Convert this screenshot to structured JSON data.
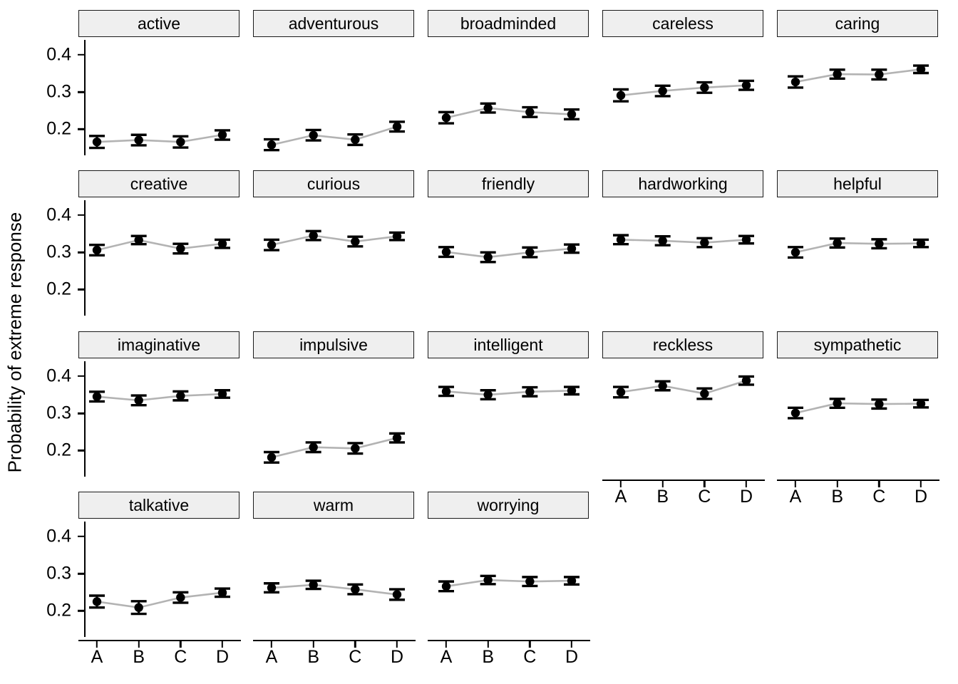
{
  "axis": {
    "y_title": "Probability of extreme response",
    "y_ticks": [
      "0.4",
      "0.3",
      "0.2"
    ],
    "y_tick_values": [
      0.4,
      0.3,
      0.2
    ],
    "x_ticks": [
      "A",
      "B",
      "C",
      "D"
    ]
  },
  "style": {
    "strip_background": "#efefef",
    "strip_border": "#1a1a1a",
    "point_color": "#000000",
    "line_color": "#b3b3b3",
    "panel_background": "#ffffff"
  },
  "chart_data": {
    "type": "line",
    "title": "",
    "xlabel": "",
    "ylabel": "Probability of extreme response",
    "categories": [
      "A",
      "B",
      "C",
      "D"
    ],
    "ylim": [
      0.13,
      0.44
    ],
    "grid": false,
    "legend": "none",
    "error_bars": "95% confidence interval",
    "facet_layout": {
      "rows": 4,
      "cols": 5
    },
    "facets": [
      {
        "name": "active",
        "row": 0,
        "col": 0,
        "values": [
          0.166,
          0.171,
          0.166,
          0.185
        ],
        "err_low": [
          0.15,
          0.157,
          0.151,
          0.172
        ],
        "err_high": [
          0.182,
          0.185,
          0.181,
          0.197
        ]
      },
      {
        "name": "adventurous",
        "row": 0,
        "col": 1,
        "values": [
          0.158,
          0.184,
          0.172,
          0.207
        ],
        "err_low": [
          0.144,
          0.17,
          0.158,
          0.194
        ],
        "err_high": [
          0.173,
          0.198,
          0.186,
          0.22
        ]
      },
      {
        "name": "broadminded",
        "row": 0,
        "col": 2,
        "values": [
          0.231,
          0.257,
          0.246,
          0.24
        ],
        "err_low": [
          0.216,
          0.245,
          0.233,
          0.227
        ],
        "err_high": [
          0.246,
          0.269,
          0.259,
          0.253
        ]
      },
      {
        "name": "careless",
        "row": 0,
        "col": 3,
        "values": [
          0.291,
          0.303,
          0.312,
          0.318
        ],
        "err_low": [
          0.275,
          0.289,
          0.298,
          0.306
        ],
        "err_high": [
          0.307,
          0.317,
          0.326,
          0.33
        ]
      },
      {
        "name": "caring",
        "row": 0,
        "col": 4,
        "values": [
          0.327,
          0.348,
          0.347,
          0.361
        ],
        "err_low": [
          0.312,
          0.336,
          0.334,
          0.351
        ],
        "err_high": [
          0.342,
          0.36,
          0.36,
          0.371
        ]
      },
      {
        "name": "creative",
        "row": 1,
        "col": 0,
        "values": [
          0.306,
          0.333,
          0.31,
          0.323
        ],
        "err_low": [
          0.292,
          0.322,
          0.297,
          0.312
        ],
        "err_high": [
          0.32,
          0.344,
          0.323,
          0.334
        ]
      },
      {
        "name": "curious",
        "row": 1,
        "col": 1,
        "values": [
          0.32,
          0.345,
          0.329,
          0.343
        ],
        "err_low": [
          0.306,
          0.333,
          0.316,
          0.333
        ],
        "err_high": [
          0.334,
          0.357,
          0.342,
          0.353
        ]
      },
      {
        "name": "friendly",
        "row": 1,
        "col": 2,
        "values": [
          0.301,
          0.287,
          0.3,
          0.31
        ],
        "err_low": [
          0.288,
          0.274,
          0.287,
          0.299
        ],
        "err_high": [
          0.314,
          0.3,
          0.313,
          0.321
        ]
      },
      {
        "name": "hardworking",
        "row": 1,
        "col": 3,
        "values": [
          0.334,
          0.331,
          0.326,
          0.334
        ],
        "err_low": [
          0.322,
          0.319,
          0.314,
          0.324
        ],
        "err_high": [
          0.346,
          0.343,
          0.338,
          0.344
        ]
      },
      {
        "name": "helpful",
        "row": 1,
        "col": 4,
        "values": [
          0.3,
          0.325,
          0.323,
          0.324
        ],
        "err_low": [
          0.286,
          0.313,
          0.311,
          0.314
        ],
        "err_high": [
          0.314,
          0.337,
          0.335,
          0.334
        ]
      },
      {
        "name": "imaginative",
        "row": 2,
        "col": 0,
        "values": [
          0.345,
          0.335,
          0.347,
          0.352
        ],
        "err_low": [
          0.332,
          0.322,
          0.335,
          0.342
        ],
        "err_high": [
          0.358,
          0.348,
          0.359,
          0.362
        ]
      },
      {
        "name": "impulsive",
        "row": 2,
        "col": 1,
        "values": [
          0.182,
          0.209,
          0.206,
          0.234
        ],
        "err_low": [
          0.168,
          0.196,
          0.192,
          0.222
        ],
        "err_high": [
          0.196,
          0.222,
          0.22,
          0.246
        ]
      },
      {
        "name": "intelligent",
        "row": 2,
        "col": 2,
        "values": [
          0.359,
          0.35,
          0.358,
          0.361
        ],
        "err_low": [
          0.347,
          0.338,
          0.346,
          0.351
        ],
        "err_high": [
          0.371,
          0.362,
          0.37,
          0.371
        ]
      },
      {
        "name": "reckless",
        "row": 2,
        "col": 3,
        "values": [
          0.357,
          0.374,
          0.353,
          0.388
        ],
        "err_low": [
          0.343,
          0.362,
          0.339,
          0.377
        ],
        "err_high": [
          0.371,
          0.386,
          0.367,
          0.399
        ]
      },
      {
        "name": "sympathetic",
        "row": 2,
        "col": 4,
        "values": [
          0.301,
          0.327,
          0.325,
          0.326
        ],
        "err_low": [
          0.287,
          0.315,
          0.313,
          0.316
        ],
        "err_high": [
          0.315,
          0.339,
          0.337,
          0.336
        ]
      },
      {
        "name": "talkative",
        "row": 3,
        "col": 0,
        "values": [
          0.225,
          0.209,
          0.236,
          0.249
        ],
        "err_low": [
          0.209,
          0.192,
          0.222,
          0.238
        ],
        "err_high": [
          0.241,
          0.226,
          0.25,
          0.26
        ]
      },
      {
        "name": "warm",
        "row": 3,
        "col": 1,
        "values": [
          0.262,
          0.27,
          0.258,
          0.244
        ],
        "err_low": [
          0.25,
          0.259,
          0.245,
          0.23
        ],
        "err_high": [
          0.274,
          0.281,
          0.271,
          0.258
        ]
      },
      {
        "name": "worrying",
        "row": 3,
        "col": 2,
        "values": [
          0.266,
          0.283,
          0.279,
          0.281
        ],
        "err_low": [
          0.253,
          0.272,
          0.267,
          0.271
        ],
        "err_high": [
          0.279,
          0.294,
          0.291,
          0.291
        ]
      }
    ]
  }
}
